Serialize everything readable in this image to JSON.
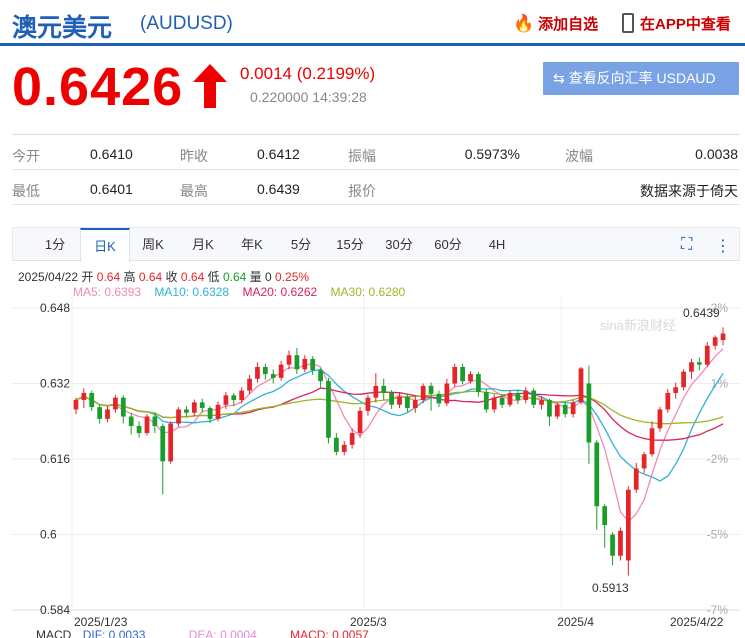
{
  "header": {
    "title": "澳元美元",
    "code": "(AUDUSD)",
    "add_watch": "添加自选",
    "open_app": "在APP中查看"
  },
  "quote": {
    "price": "0.6426",
    "change": "0.0014 (0.2199%)",
    "time": "0.220000 14:39:28",
    "reverse_button": "查看反向汇率 USDAUD"
  },
  "stats": {
    "row1": [
      {
        "label": "今开",
        "value": "0.6410"
      },
      {
        "label": "昨收",
        "value": "0.6412"
      },
      {
        "label": "振幅",
        "value": "0.5973%"
      },
      {
        "label": "波幅",
        "value": "0.0038"
      }
    ],
    "row2": [
      {
        "label": "最低",
        "value": "0.6401"
      },
      {
        "label": "最高",
        "value": "0.6439"
      },
      {
        "label": "报价",
        "value": ""
      },
      {
        "label": "",
        "value": "数据来源于倚天"
      }
    ]
  },
  "tabs": [
    "1分",
    "日K",
    "周K",
    "月K",
    "年K",
    "5分",
    "15分",
    "30分",
    "60分",
    "4H"
  ],
  "active_tab": "日K",
  "info": {
    "date": "2025/04/22",
    "open_label": "开",
    "open": "0.64",
    "high_label": "高",
    "high": "0.64",
    "close_label": "收",
    "close": "0.64",
    "low_label": "低",
    "low": "0.64",
    "vol_label": "量",
    "vol": "0",
    "pct": "0.25%"
  },
  "ma": {
    "ma5": "MA5: 0.6393",
    "ma10": "MA10: 0.6328",
    "ma20": "MA20: 0.6262",
    "ma30": "MA30: 0.6280"
  },
  "macd": {
    "macd": "MACD",
    "dif": "DIF: 0.0033",
    "dea": "DEA: 0.0004",
    "val": "MACD: 0.0057"
  },
  "colors": {
    "up": "#e4262b",
    "down": "#1a9d2a",
    "ma5": "#f28ab6",
    "ma10": "#2fb4d8",
    "ma20": "#d8235a",
    "ma30": "#9cb728",
    "brand": "#1f5fb8"
  },
  "chart_data": {
    "type": "candlestick",
    "y_ticks": [
      "0.648",
      "0.632",
      "0.616",
      "0.6",
      "0.584"
    ],
    "y_ticks_right": [
      "2%",
      "1%",
      "-2%",
      "-5%",
      "-7%"
    ],
    "ylim": [
      0.584,
      0.648
    ],
    "x_labels": [
      "2025/1/23",
      "2025/3",
      "2025/4",
      "2025/4/22"
    ],
    "annotations": {
      "high": "0.6439",
      "low": "0.5913"
    },
    "watermark": "sina新浪财经",
    "candles": [
      [
        0.6265,
        0.6285,
        0.6255,
        0.629
      ],
      [
        0.6285,
        0.63,
        0.6268,
        0.631
      ],
      [
        0.63,
        0.627,
        0.6262,
        0.6305
      ],
      [
        0.627,
        0.6245,
        0.6235,
        0.6275
      ],
      [
        0.6245,
        0.6265,
        0.6238,
        0.6272
      ],
      [
        0.6265,
        0.629,
        0.6258,
        0.6296
      ],
      [
        0.629,
        0.625,
        0.6235,
        0.6295
      ],
      [
        0.625,
        0.623,
        0.6212,
        0.6258
      ],
      [
        0.623,
        0.6215,
        0.6205,
        0.624
      ],
      [
        0.6215,
        0.625,
        0.621,
        0.6255
      ],
      [
        0.625,
        0.623,
        0.6215,
        0.6258
      ],
      [
        0.623,
        0.6155,
        0.6085,
        0.6235
      ],
      [
        0.6155,
        0.6235,
        0.615,
        0.624
      ],
      [
        0.6235,
        0.6265,
        0.6228,
        0.627
      ],
      [
        0.6265,
        0.6258,
        0.6248,
        0.6272
      ],
      [
        0.6258,
        0.628,
        0.625,
        0.6286
      ],
      [
        0.628,
        0.6268,
        0.6258,
        0.6288
      ],
      [
        0.6268,
        0.6245,
        0.6236,
        0.6272
      ],
      [
        0.6245,
        0.6275,
        0.624,
        0.6282
      ],
      [
        0.6275,
        0.6295,
        0.6266,
        0.6302
      ],
      [
        0.6295,
        0.6285,
        0.6272,
        0.63
      ],
      [
        0.6285,
        0.6305,
        0.6278,
        0.6312
      ],
      [
        0.6305,
        0.633,
        0.6298,
        0.6338
      ],
      [
        0.633,
        0.6355,
        0.6322,
        0.6365
      ],
      [
        0.6355,
        0.634,
        0.6328,
        0.6362
      ],
      [
        0.634,
        0.6332,
        0.632,
        0.635
      ],
      [
        0.6332,
        0.636,
        0.6326,
        0.6368
      ],
      [
        0.636,
        0.638,
        0.635,
        0.639
      ],
      [
        0.638,
        0.635,
        0.634,
        0.6395
      ],
      [
        0.635,
        0.6372,
        0.6344,
        0.638
      ],
      [
        0.6372,
        0.6348,
        0.6338,
        0.6378
      ],
      [
        0.6348,
        0.6325,
        0.6312,
        0.6352
      ],
      [
        0.6325,
        0.6205,
        0.6193,
        0.6332
      ],
      [
        0.6205,
        0.6175,
        0.6168,
        0.6215
      ],
      [
        0.6175,
        0.619,
        0.6168,
        0.6198
      ],
      [
        0.619,
        0.6215,
        0.6182,
        0.6225
      ],
      [
        0.6215,
        0.6262,
        0.6205,
        0.627
      ],
      [
        0.6262,
        0.629,
        0.6252,
        0.6296
      ],
      [
        0.629,
        0.6315,
        0.628,
        0.6342
      ],
      [
        0.6315,
        0.63,
        0.6285,
        0.633
      ],
      [
        0.63,
        0.6275,
        0.6266,
        0.6306
      ],
      [
        0.6275,
        0.6292,
        0.6268,
        0.63
      ],
      [
        0.6292,
        0.6268,
        0.626,
        0.6298
      ],
      [
        0.6268,
        0.6285,
        0.6258,
        0.6295
      ],
      [
        0.6285,
        0.6315,
        0.6278,
        0.632
      ],
      [
        0.6315,
        0.6298,
        0.6262,
        0.6322
      ],
      [
        0.6298,
        0.6278,
        0.627,
        0.6305
      ],
      [
        0.6278,
        0.632,
        0.6272,
        0.633
      ],
      [
        0.632,
        0.6355,
        0.6312,
        0.6362
      ],
      [
        0.6355,
        0.6325,
        0.6318,
        0.6362
      ],
      [
        0.6325,
        0.634,
        0.632,
        0.6346
      ],
      [
        0.634,
        0.6302,
        0.6292,
        0.6345
      ],
      [
        0.6302,
        0.6265,
        0.6258,
        0.6308
      ],
      [
        0.6265,
        0.629,
        0.6258,
        0.6297
      ],
      [
        0.629,
        0.6275,
        0.6268,
        0.6296
      ],
      [
        0.6275,
        0.63,
        0.627,
        0.6306
      ],
      [
        0.63,
        0.6285,
        0.6276,
        0.6305
      ],
      [
        0.6285,
        0.6305,
        0.6278,
        0.6312
      ],
      [
        0.6305,
        0.6275,
        0.6268,
        0.631
      ],
      [
        0.6275,
        0.6285,
        0.6265,
        0.6292
      ],
      [
        0.6285,
        0.625,
        0.623,
        0.6288
      ],
      [
        0.625,
        0.6275,
        0.6245,
        0.628
      ],
      [
        0.6275,
        0.6255,
        0.6248,
        0.628
      ],
      [
        0.6255,
        0.628,
        0.6248,
        0.6286
      ],
      [
        0.628,
        0.6352,
        0.6276,
        0.6355
      ],
      [
        0.632,
        0.6195,
        0.615,
        0.6358
      ],
      [
        0.6195,
        0.606,
        0.601,
        0.62
      ],
      [
        0.606,
        0.602,
        0.5972,
        0.6065
      ],
      [
        0.6,
        0.5955,
        0.5935,
        0.6005
      ],
      [
        0.5955,
        0.6008,
        0.5945,
        0.6015
      ],
      [
        0.5945,
        0.6095,
        0.5913,
        0.6102
      ],
      [
        0.6095,
        0.614,
        0.6088,
        0.6152
      ],
      [
        0.614,
        0.617,
        0.613,
        0.6175
      ],
      [
        0.617,
        0.6225,
        0.6165,
        0.624
      ],
      [
        0.6225,
        0.6265,
        0.6218,
        0.627
      ],
      [
        0.6265,
        0.63,
        0.6258,
        0.6308
      ],
      [
        0.63,
        0.6312,
        0.6288,
        0.6322
      ],
      [
        0.6312,
        0.6345,
        0.6305,
        0.635
      ],
      [
        0.6345,
        0.6365,
        0.633,
        0.6372
      ],
      [
        0.6365,
        0.636,
        0.6348,
        0.6375
      ],
      [
        0.636,
        0.64,
        0.6355,
        0.6408
      ],
      [
        0.64,
        0.6418,
        0.6392,
        0.6422
      ],
      [
        0.6412,
        0.6426,
        0.6401,
        0.6439
      ]
    ]
  }
}
